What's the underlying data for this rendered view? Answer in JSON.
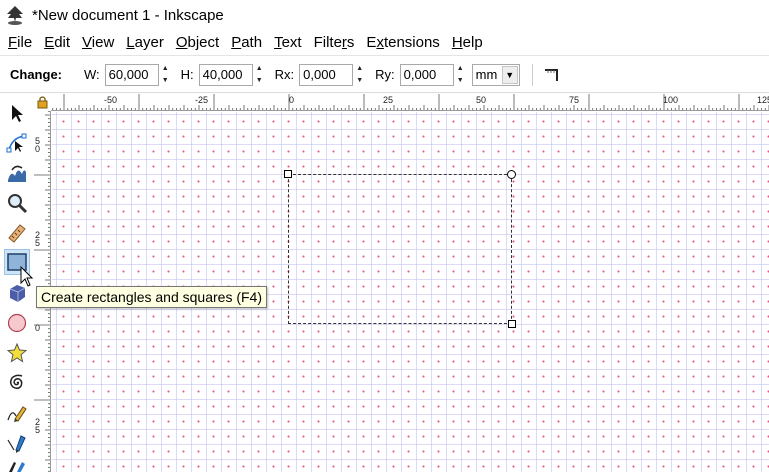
{
  "window": {
    "title": "*New document 1 - Inkscape",
    "icon": "inkscape-logo-icon"
  },
  "menu": [
    {
      "label": "File",
      "accel": "F",
      "rest": "ile"
    },
    {
      "label": "Edit",
      "accel": "E",
      "rest": "dit"
    },
    {
      "label": "View",
      "accel": "V",
      "rest": "iew"
    },
    {
      "label": "Layer",
      "accel": "L",
      "rest": "ayer"
    },
    {
      "label": "Object",
      "accel": "O",
      "rest": "bject"
    },
    {
      "label": "Path",
      "accel": "P",
      "rest": "ath"
    },
    {
      "label": "Text",
      "accel": "T",
      "rest": "ext"
    },
    {
      "label": "Filters",
      "pre": "Filte",
      "accel": "r",
      "rest": "s"
    },
    {
      "label": "Extensions",
      "pre": "E",
      "accel": "x",
      "rest": "tensions"
    },
    {
      "label": "Help",
      "accel": "H",
      "rest": "elp"
    }
  ],
  "toolbar": {
    "change_label": "Change:",
    "w_label": "W:",
    "w_value": "60,000",
    "h_label": "H:",
    "h_value": "40,000",
    "rx_label": "Rx:",
    "rx_value": "0,000",
    "ry_label": "Ry:",
    "ry_value": "0,000",
    "unit": "mm",
    "extra_icon": "rectangle-corner-reset-icon"
  },
  "tools": [
    {
      "name": "selector-tool",
      "icon": "arrow-pointer-icon"
    },
    {
      "name": "node-tool",
      "icon": "node-edit-icon"
    },
    {
      "name": "tweak-tool",
      "icon": "tweak-icon"
    },
    {
      "name": "zoom-tool",
      "icon": "magnifier-icon"
    },
    {
      "name": "measure-tool",
      "icon": "ruler-icon"
    },
    {
      "name": "rectangle-tool",
      "icon": "rectangle-icon",
      "active": true
    },
    {
      "name": "3d-box-tool",
      "icon": "cube-icon"
    },
    {
      "name": "circle-tool",
      "icon": "circle-icon"
    },
    {
      "name": "star-tool",
      "icon": "star-icon"
    },
    {
      "name": "spiral-tool",
      "icon": "spiral-icon"
    },
    {
      "name": "pencil-tool",
      "icon": "pencil-icon"
    },
    {
      "name": "pen-tool",
      "icon": "pen-icon"
    },
    {
      "name": "calligraphy-tool",
      "icon": "calligraphy-icon"
    }
  ],
  "rulers": {
    "horizontal": [
      "-50",
      "-25",
      "0",
      "25",
      "50",
      "75",
      "100",
      "125"
    ],
    "vertical": [
      "5\n0",
      "2\n5",
      "0",
      "2\n5"
    ]
  },
  "tooltip": {
    "text": "Create rectangles and squares (F4)"
  },
  "colors": {
    "selection_dash": "#333333",
    "grid_line": "#bebef0",
    "grid_dot": "#dc3c78",
    "tooltip_bg": "#ffffe1"
  }
}
